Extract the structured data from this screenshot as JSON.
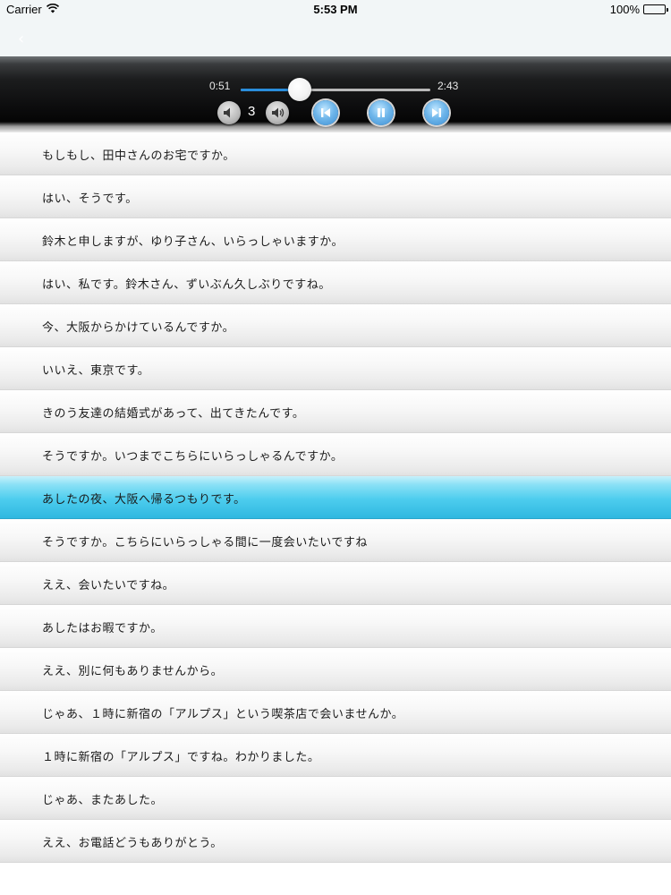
{
  "status_bar": {
    "carrier": "Carrier",
    "time": "5:53 PM",
    "battery": "100%"
  },
  "nav": {
    "back_icon": "chevron-left-icon"
  },
  "player": {
    "current_time": "0:51",
    "total_time": "2:43",
    "progress": 0.31,
    "volume_level": "3",
    "accent_color": "#3d8ed3"
  },
  "dialogue": [
    "もしもし、田中さんのお宅ですか。",
    "はい、そうです。",
    "鈴木と申しますが、ゆり子さん、いらっしゃいますか。",
    "はい、私です。鈴木さん、ずいぶん久しぶりですね。",
    "今、大阪からかけているんですか。",
    "いいえ、東京です。",
    "きのう友達の結婚式があって、出てきたんです。",
    "そうですか。いつまでこちらにいらっしゃるんですか。",
    "あしたの夜、大阪へ帰るつもりです。",
    "そうですか。こちらにいらっしゃる間に一度会いたいですね",
    "ええ、会いたいですね。",
    "あしたはお暇ですか。",
    "ええ、別に何もありませんから。",
    "じゃあ、１時に新宿の「アルプス」という喫茶店で会いませんか。",
    "１時に新宿の「アルプス」ですね。わかりました。",
    "じゃあ、またあした。",
    "ええ、お電話どうもありがとう。"
  ],
  "selected_index": 8,
  "selected_color": "#4dcdee"
}
